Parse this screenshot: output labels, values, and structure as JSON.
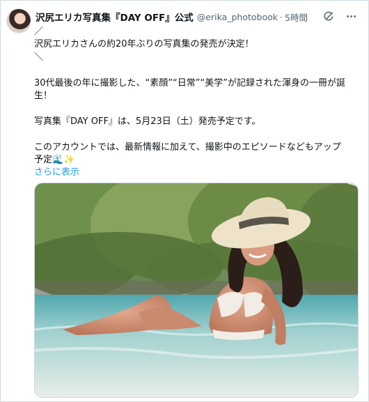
{
  "tweet": {
    "display_name": "沢尻エリカ写真集『DAY OFF』公式",
    "handle": "@erika_photobook",
    "separator": "·",
    "time": "5時間",
    "lines": [
      "／",
      "沢尻エリカさんの約20年ぶりの写真集の発売が決定！",
      "＼",
      "",
      "30代最後の年に撮影した、“素顔”“日常”“美学”が記録された渾身の一冊が誕",
      "生！",
      "",
      "写真集『DAY OFF』は、5月23日（土）発売予定です。",
      "",
      "このアカウントでは、最新情報に加えて、撮影中のエピソードなどもアップ",
      "予定🌊✨"
    ],
    "show_more": "さらに表示"
  },
  "icons": {
    "avatar": "avatar",
    "grok": "grok-icon",
    "more": "more-icon"
  },
  "colors": {
    "link": "#1d9bf0",
    "secondary_text": "#536471",
    "border": "#cfd9de"
  }
}
